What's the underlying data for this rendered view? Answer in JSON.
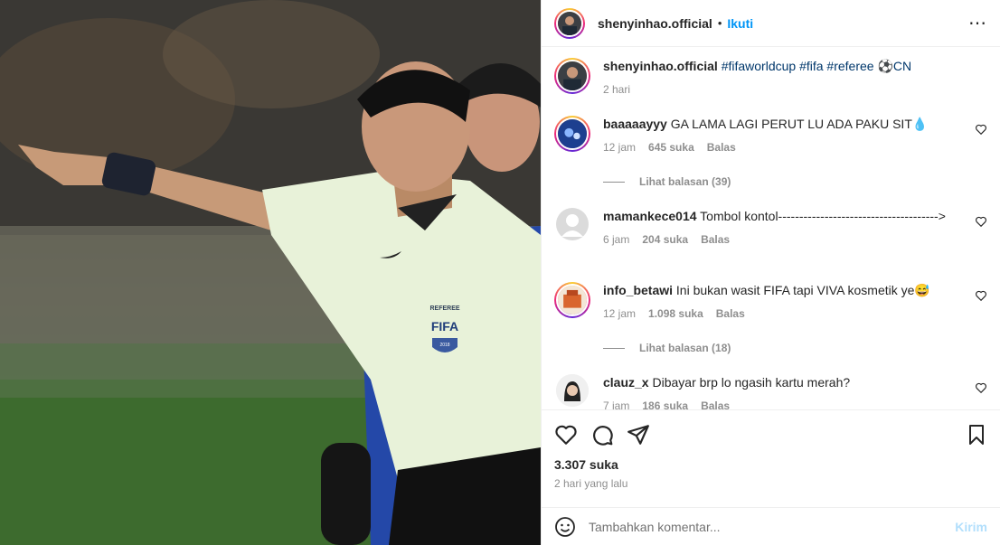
{
  "post": {
    "author": "shenyinhao.official",
    "follow_label": "Ikuti",
    "separator": "•",
    "more_label": "⋯"
  },
  "caption": {
    "user": "shenyinhao.official",
    "tags": "#fifaworldcup #fifa #referee ⚽CN",
    "time": "2 hari"
  },
  "comments": [
    {
      "user": "baaaaayyy",
      "text": "GA LAMA LAGI PERUT LU ADA PAKU SIT💧",
      "time": "12 jam",
      "likes": "645 suka",
      "reply": "Balas",
      "replies": "Lihat balasan (39)"
    },
    {
      "user": "mamankece014",
      "text": "Tombol kontol-------------------------------------->",
      "time": "6 jam",
      "likes": "204 suka",
      "reply": "Balas",
      "replies": ""
    },
    {
      "user": "info_betawi",
      "text": "Ini bukan wasit FIFA tapi VIVA kosmetik ye😅",
      "time": "12 jam",
      "likes": "1.098 suka",
      "reply": "Balas",
      "replies": "Lihat balasan (18)"
    },
    {
      "user": "clauz_x",
      "text": "Dibayar brp lo ngasih kartu merah?",
      "time": "7 jam",
      "likes": "186 suka",
      "reply": "Balas",
      "replies": ""
    }
  ],
  "stats": {
    "likes": "3.307 suka",
    "ago": "2 hari yang lalu"
  },
  "add_comment": {
    "placeholder": "Tambahkan komentar...",
    "send_label": "Kirim"
  },
  "media_text": {
    "badge_top": "REFEREE",
    "badge_main": "FIFA",
    "badge_year": "2018"
  },
  "colors": {
    "accent": "#0095f6",
    "send_disabled": "#b2dffc",
    "shirt": "#e6f0d8"
  }
}
